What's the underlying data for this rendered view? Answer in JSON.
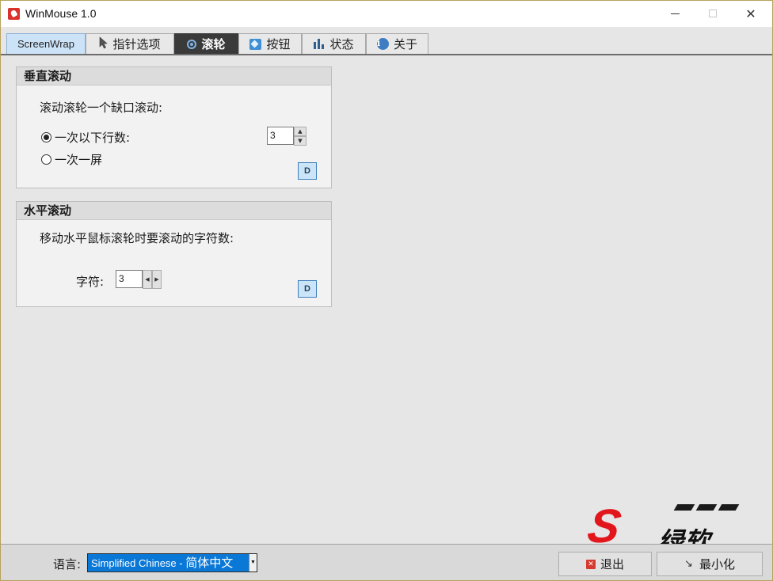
{
  "window": {
    "title": "WinMouse 1.0",
    "minimize_glyph": "—",
    "maximize_glyph": "☐",
    "close_glyph": "✕"
  },
  "tabs": [
    {
      "label": "ScreenWrap",
      "icon": "none",
      "selected": false
    },
    {
      "label": "指针选项",
      "icon": "pointer-icon",
      "selected": false
    },
    {
      "label": "滚轮",
      "icon": "wheel-icon",
      "selected": true
    },
    {
      "label": "按钮",
      "icon": "button-icon",
      "selected": false
    },
    {
      "label": "状态",
      "icon": "bar-chart-icon",
      "selected": false
    },
    {
      "label": "关于",
      "icon": "info-icon",
      "selected": false
    }
  ],
  "vertical": {
    "header": "垂直滚动",
    "description": "滚动滚轮一个缺口滚动:",
    "option_lines": "一次以下行数:",
    "option_screen": "一次一屏",
    "selected_option": "lines",
    "lines_value": "3",
    "default_label": "D"
  },
  "horizontal": {
    "header": "水平滚动",
    "description": "移动水平鼠标滚轮时要滚动的字符数:",
    "chars_label": "字符:",
    "chars_value": "3",
    "default_label": "D"
  },
  "footer": {
    "language_label": "语言:",
    "language_value_en": "Simplified Chinese  -  ",
    "language_value_cn": "简体中文",
    "exit_label": "退出",
    "minimize_label": "最小化"
  },
  "watermark": {
    "text": "绿软"
  },
  "colors": {
    "accent": "#0a78d7",
    "selected_tab": "#3a3a3a",
    "screenwrap_tab": "#cce3f7",
    "watermark_red": "#e3161c",
    "exit_icon": "#d43a2f"
  }
}
